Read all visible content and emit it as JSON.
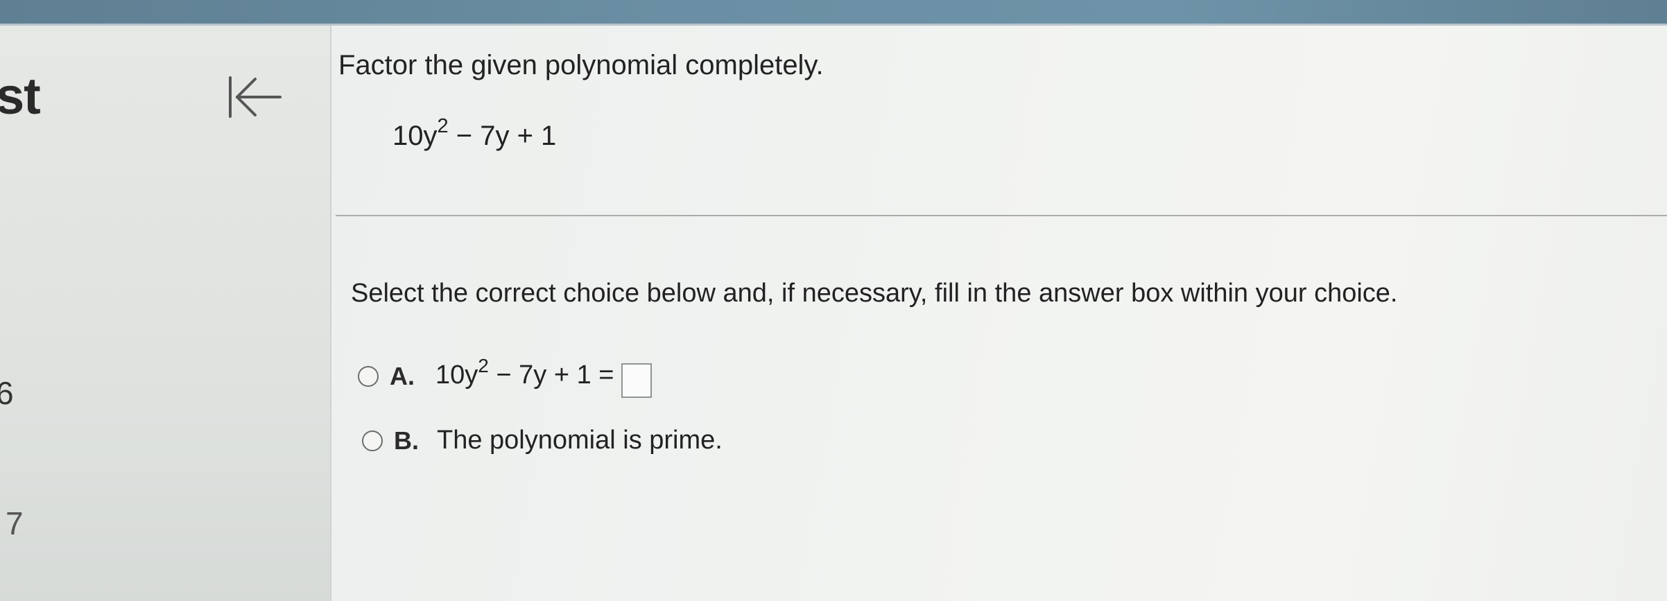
{
  "sidebar": {
    "partial_title": "st",
    "items": [
      "6",
      "7"
    ]
  },
  "nav": {
    "back_icon": "back-to-start-icon"
  },
  "question": {
    "title": "Factor the given polynomial completely.",
    "polynomial": {
      "coef": "10y",
      "exponent": "2",
      "rest": " − 7y + 1"
    },
    "instruction": "Select the correct choice below and, if necessary, fill in the answer box within your choice."
  },
  "choices": [
    {
      "letter": "A.",
      "expr_coef": "10y",
      "expr_exponent": "2",
      "expr_rest": " − 7y + 1 =",
      "selected": false
    },
    {
      "letter": "B.",
      "text": "The polynomial is prime.",
      "selected": false
    }
  ],
  "colors": {
    "top_bar": "#6a8ea3",
    "text": "#222222",
    "divider": "#a9aeab"
  }
}
